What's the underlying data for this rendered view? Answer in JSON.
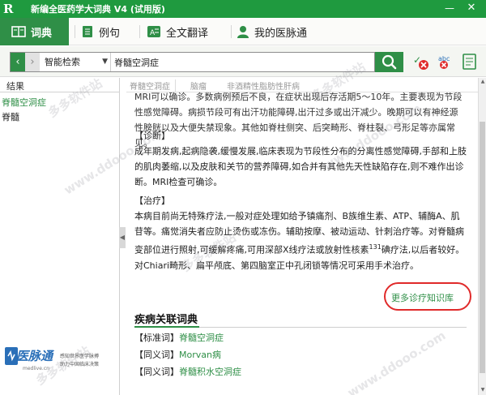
{
  "window": {
    "title": "新编全医药学大词典 V4 (试用版)",
    "logo_text": "R",
    "minimize_glyph": "—",
    "close_glyph": "✕"
  },
  "nav": {
    "tabs": [
      {
        "label": "词典",
        "icon": "book-icon",
        "active": true
      },
      {
        "label": "例句",
        "icon": "notebook-icon",
        "active": false
      },
      {
        "label": "全文翻译",
        "icon": "translate-icon",
        "active": false
      },
      {
        "label": "我的医脉通",
        "icon": "user-icon",
        "active": false
      }
    ]
  },
  "search": {
    "back_glyph": "‹",
    "forward_glyph": "›",
    "mode": "智能检索",
    "mode_caret": "▼",
    "query": "脊髓空洞症",
    "button_icon": "magnifier-icon",
    "tools": [
      "cancel-check-icon",
      "spellcheck-abc-icon",
      "notes-icon"
    ],
    "tool_abc_label": "abc"
  },
  "results": {
    "header": "结果",
    "items": [
      "脊髓空洞症",
      "脊髓"
    ]
  },
  "brand": {
    "logo": "医脉通",
    "sub": "medlive.cn",
    "slogan_line1": "感知世界医学脉搏",
    "slogan_line2": "助力中国临床决策"
  },
  "content": {
    "tabs": [
      "脊髓空洞症",
      "脑瘤",
      "非酒精性脂肪性肝病"
    ],
    "para_top": "MRI可以确诊。多数病例预后不良，在症状出现后存活期5～10年。主要表现为节段性感觉障碍。病损节段可有出汗功能障碍,出汗过多或出汗减少。晚期可以有神经源性膀胱以及大便失禁现象。其他如脊柱侧突、后突畸形、脊柱裂、弓形足等亦属常见。",
    "sec_diag": "【诊断】",
    "diag": "成年期发病,起病隐袭,缓慢发展,临床表现为节段性分布的分离性感觉障碍,手部和上肢的肌肉萎缩,以及皮肤和关节的营养障碍,如合并有其他先天性缺陷存在,则不难作出诊断。MRI检查可确诊。",
    "sec_treat": "【治疗】",
    "treat_a": "本病目前尚无特殊疗法,一般对症处理如给予镇痛剂、B族维生素、ATP、辅酶A、肌苷等。痛觉消失者应防止烫伤或冻伤。辅助按摩、被动运动、针刺治疗等。对脊髓病变部位进行照射,可缓解疼痛,可用深部X线疗法或放射性核素",
    "treat_sup": "131",
    "treat_b": "碘疗法,以后者较好。对Chiari畸形、扁平颅底、第四脑室正中孔闭锁等情况可采用手术治疗。",
    "more_link": "更多诊疗知识库",
    "related_title": "疾病关联词典",
    "related": [
      {
        "prefix": "【标准词】",
        "term": "脊髓空洞症"
      },
      {
        "prefix": "【同义词】",
        "term": "Morvan病"
      },
      {
        "prefix": "【同义词】",
        "term": "脊髓积水空洞症"
      }
    ]
  },
  "scroll": {
    "up_glyph": "▲",
    "down_glyph": "▼"
  },
  "splitter_glyph": "◀",
  "watermark": "多多软件站",
  "watermark_url": "www.ddooo.com",
  "colors": {
    "brand_green": "#2f8f47",
    "title_green": "#1f9a3f",
    "annotation_red": "#e02a2a"
  }
}
